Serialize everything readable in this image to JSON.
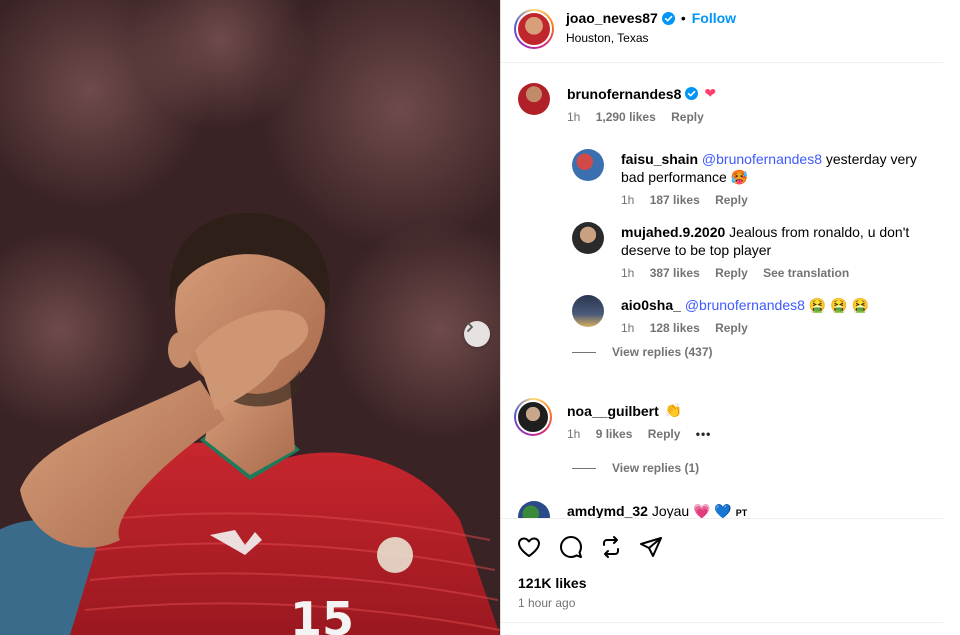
{
  "post": {
    "username": "joao_neves87",
    "separator": "•",
    "follow_label": "Follow",
    "location": "Houston, Texas",
    "likes": "121K likes",
    "time_ago": "1 hour ago",
    "jersey_number": "15"
  },
  "comments": [
    {
      "username": "brunofernandes8",
      "text": "",
      "emoji": "❤",
      "time": "1h",
      "likes": "1,290 likes",
      "reply": "Reply"
    },
    {
      "username": "faisu_shain",
      "mention": "@brunofernandes8",
      "text": "yesterday very bad performance",
      "emoji": "🥵",
      "time": "1h",
      "likes": "187 likes",
      "reply": "Reply"
    },
    {
      "username": "mujahed.9.2020",
      "text": "Jealous from ronaldo, u don't deserve to be top player",
      "time": "1h",
      "likes": "387 likes",
      "reply": "Reply",
      "see_translation": "See translation"
    },
    {
      "username": "aio0sha_",
      "mention": "@brunofernandes8",
      "emoji": "🤮 🤮 🤮",
      "time": "1h",
      "likes": "128 likes",
      "reply": "Reply"
    },
    {
      "username": "noa__guilbert",
      "emoji": "👏",
      "time": "1h",
      "likes": "9 likes",
      "reply": "Reply",
      "more": "•••"
    },
    {
      "username": "amdymd_32",
      "text": "Joyau",
      "emoji": "💗 💙",
      "suffix": "PT"
    }
  ],
  "view_replies": [
    {
      "label": "View replies (437)"
    },
    {
      "label": "View replies (1)"
    }
  ],
  "colors": {
    "link_blue": "#0095f6",
    "verified_blue": "#0095f6",
    "muted": "#737373",
    "heart_pink": "#ff3e6c"
  },
  "icons": [
    "heart-icon",
    "comment-icon",
    "repost-icon",
    "share-icon",
    "verified-icon",
    "chevron-right-icon",
    "more-icon"
  ]
}
